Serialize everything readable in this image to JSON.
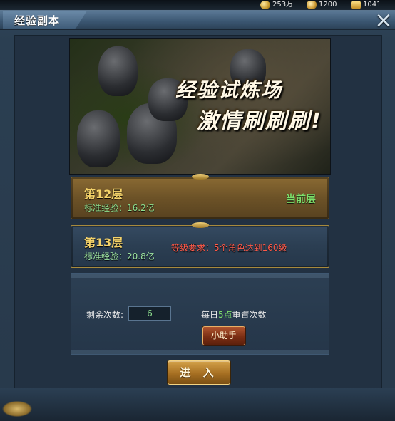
{
  "currencies": [
    {
      "icon": "gold-coin-icon",
      "value": "253万"
    },
    {
      "icon": "gold-ingot-icon",
      "value": "1200"
    },
    {
      "icon": "gold-bar-icon",
      "value": "1041"
    }
  ],
  "window": {
    "title": "经验副本",
    "close_icon": "×"
  },
  "banner": {
    "line1": "经验试炼场",
    "line2": "激情刷刷刷!"
  },
  "floors": [
    {
      "name": "第12层",
      "exp_label": "标准经验：16.2亿",
      "status": "当前层",
      "requirement": ""
    },
    {
      "name": "第13层",
      "exp_label": "标准经验：20.8亿",
      "status": "",
      "requirement": "等级要求：5个角色达到160级"
    }
  ],
  "info": {
    "remaining_label": "剩余次数:",
    "remaining_value": "6",
    "reset_prefix": "每日",
    "reset_highlight": "5点",
    "reset_suffix": "重置次数"
  },
  "buttons": {
    "helper": "小助手",
    "enter": "进 入"
  },
  "colors": {
    "current_status": "#7ee06a",
    "requirement": "#ff5a4a",
    "floor_name": "#f5d36a"
  }
}
